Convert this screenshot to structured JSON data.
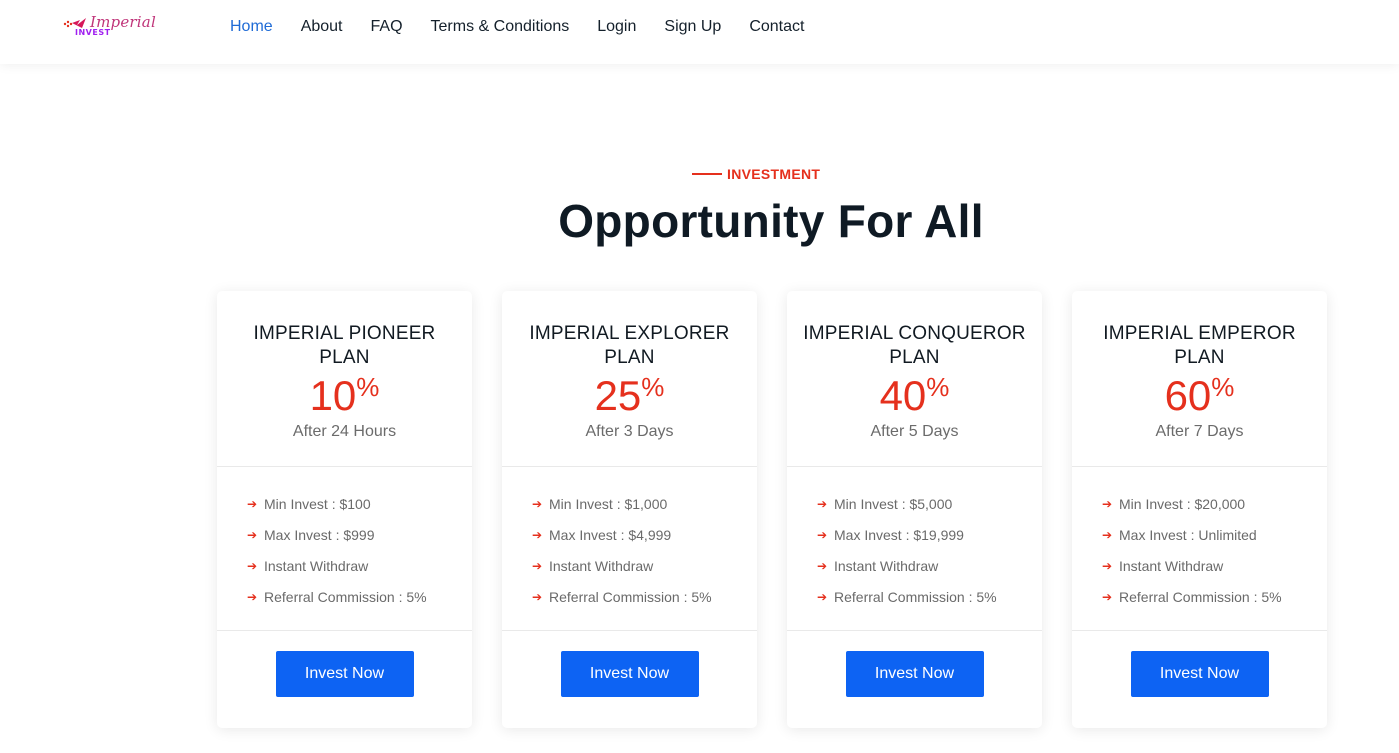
{
  "logo": {
    "word": "Imperial",
    "sub": "INVEST"
  },
  "nav": [
    "Home",
    "About",
    "FAQ",
    "Terms & Conditions",
    "Login",
    "Sign Up",
    "Contact"
  ],
  "nav_active": "Home",
  "section": {
    "eyebrow": "INVESTMENT",
    "title": "Opportunity For All"
  },
  "plans": [
    {
      "name": "IMPERIAL PIONEER PLAN",
      "rate": "10",
      "rate_unit": "%",
      "period": "After 24 Hours",
      "features": [
        "Min Invest : $100",
        "Max Invest : $999",
        "Instant Withdraw",
        "Referral Commission : 5%"
      ],
      "button": "Invest Now"
    },
    {
      "name": "IMPERIAL EXPLORER PLAN",
      "rate": "25",
      "rate_unit": "%",
      "period": "After 3 Days",
      "features": [
        "Min Invest : $1,000",
        "Max Invest : $4,999",
        "Instant Withdraw",
        "Referral Commission : 5%"
      ],
      "button": "Invest Now"
    },
    {
      "name": "IMPERIAL CONQUEROR PLAN",
      "rate": "40",
      "rate_unit": "%",
      "period": "After 5 Days",
      "features": [
        "Min Invest : $5,000",
        "Max Invest : $19,999",
        "Instant Withdraw",
        "Referral Commission : 5%"
      ],
      "button": "Invest Now"
    },
    {
      "name": "IMPERIAL EMPEROR PLAN",
      "rate": "60",
      "rate_unit": "%",
      "period": "After 7 Days",
      "features": [
        "Min Invest : $20,000",
        "Max Invest : Unlimited",
        "Instant Withdraw",
        "Referral Commission : 5%"
      ],
      "button": "Invest Now"
    }
  ],
  "colors": {
    "accent_red": "#e5301d",
    "button_blue": "#0d63f3",
    "nav_active": "#1f6bd6"
  }
}
